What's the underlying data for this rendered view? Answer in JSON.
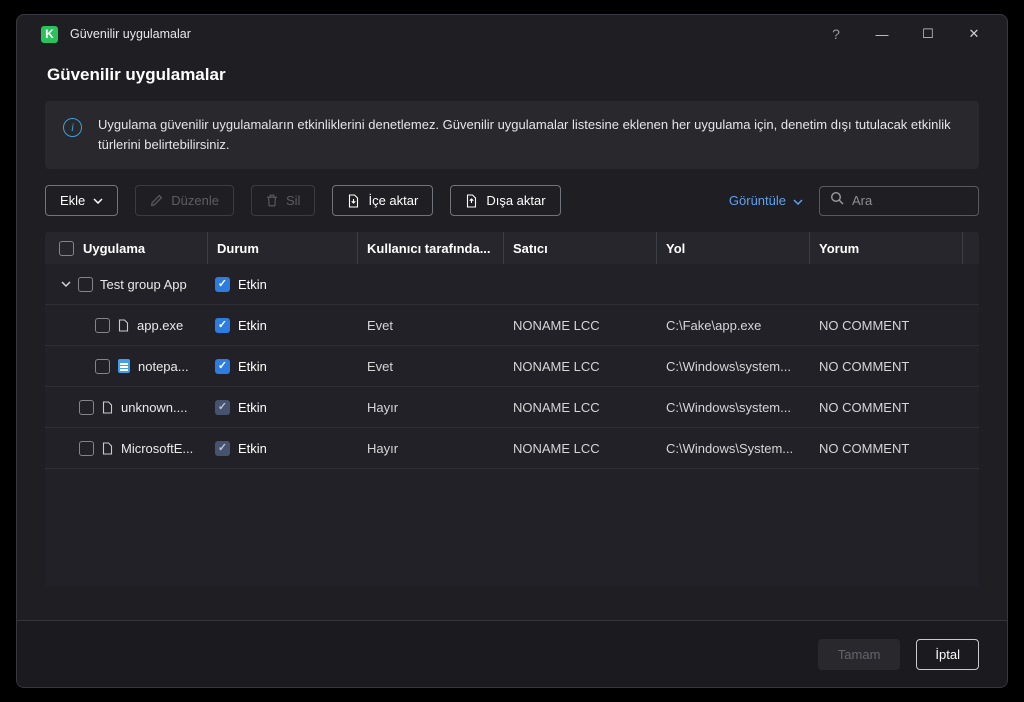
{
  "window": {
    "title": "Güvenilir uygulamalar",
    "controls": {
      "help": "?",
      "minimize": "—",
      "maximize": "☐",
      "close": "✕"
    }
  },
  "page": {
    "title": "Güvenilir uygulamalar",
    "info_text": "Uygulama güvenilir uygulamaların etkinliklerini denetlemez. Güvenilir uygulamalar listesine eklenen her uygulama için, denetim dışı tutulacak etkinlik türlerini belirtebilirsiniz."
  },
  "toolbar": {
    "add_label": "Ekle",
    "edit_label": "Düzenle",
    "delete_label": "Sil",
    "import_label": "İçe aktar",
    "export_label": "Dışa aktar",
    "view_label": "Görüntüle",
    "search_placeholder": "Ara"
  },
  "table": {
    "columns": [
      "Uygulama",
      "Durum",
      "Kullanıcı tarafında...",
      "Satıcı",
      "Yol",
      "Yorum"
    ],
    "group": {
      "name": "Test group App",
      "status": "Etkin"
    },
    "rows": [
      {
        "name": "app.exe",
        "status": "Etkin",
        "user": "Evet",
        "vendor": "NONAME LCC",
        "path": "C:\\Fake\\app.exe",
        "comment": "NO COMMENT"
      },
      {
        "name": "notepa...",
        "status": "Etkin",
        "user": "Evet",
        "vendor": "NONAME LCC",
        "path": "C:\\Windows\\system...",
        "comment": "NO COMMENT"
      },
      {
        "name": "unknown....",
        "status": "Etkin",
        "user": "Hayır",
        "vendor": "NONAME LCC",
        "path": "C:\\Windows\\system...",
        "comment": "NO COMMENT"
      },
      {
        "name": "MicrosoftE...",
        "status": "Etkin",
        "user": "Hayır",
        "vendor": "NONAME LCC",
        "path": "C:\\Windows\\System...",
        "comment": "NO COMMENT"
      }
    ]
  },
  "footer": {
    "ok_label": "Tamam",
    "cancel_label": "İptal"
  },
  "colors": {
    "brand_green": "#2bc15c",
    "checkbox_blue": "#2d7ce0",
    "checkbox_muted": "#46536e",
    "link_blue": "#5ea1f0",
    "info_blue": "#3b9fe0"
  }
}
